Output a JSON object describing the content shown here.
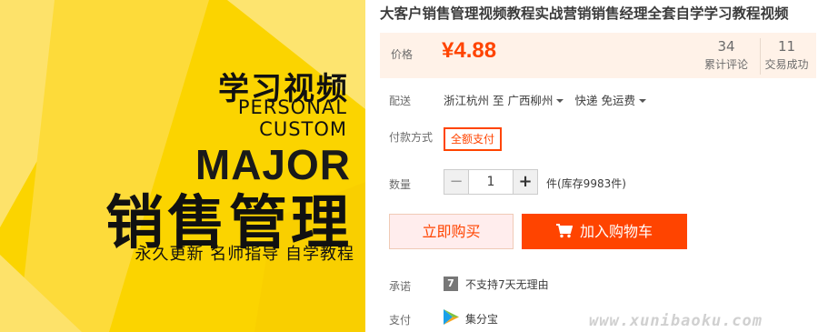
{
  "hero": {
    "headline_cn": "学习视频",
    "line1": "PERSONAL",
    "line2": "CUSTOM",
    "major": "MAJOR",
    "big_title": "销售管理",
    "subtitle": "永久更新  名师指导  自学教程",
    "colors": {
      "yellow": "#fbd400",
      "light_yellow": "#fde26a",
      "dark": "#111111"
    }
  },
  "product": {
    "title": "大客户销售管理视频教程实战营销销售经理全套自学学习教程视频",
    "price_label": "价格",
    "price": "¥4.88",
    "reviews_count": "34",
    "reviews_label": "累计评论",
    "trades_count": "11",
    "trades_label": "交易成功"
  },
  "shipping": {
    "label": "配送",
    "from": "浙江杭州 至",
    "to": "广西柳州",
    "method": "快递 免运费"
  },
  "payment": {
    "label": "付款方式",
    "option": "全额支付"
  },
  "quantity": {
    "label": "数量",
    "minus": "−",
    "value": "1",
    "plus": "+",
    "stock": "件(库存9983件)"
  },
  "actions": {
    "buy_now": "立即购买",
    "add_to_cart": "加入购物车"
  },
  "promise": {
    "label": "承诺",
    "badge": "7",
    "text": "不支持7天无理由"
  },
  "pay_service": {
    "label": "支付",
    "text": "集分宝"
  },
  "watermark": "www.xunibaoku.com",
  "colors": {
    "accent": "#ff4400",
    "price_bg": "#fff2e8"
  }
}
